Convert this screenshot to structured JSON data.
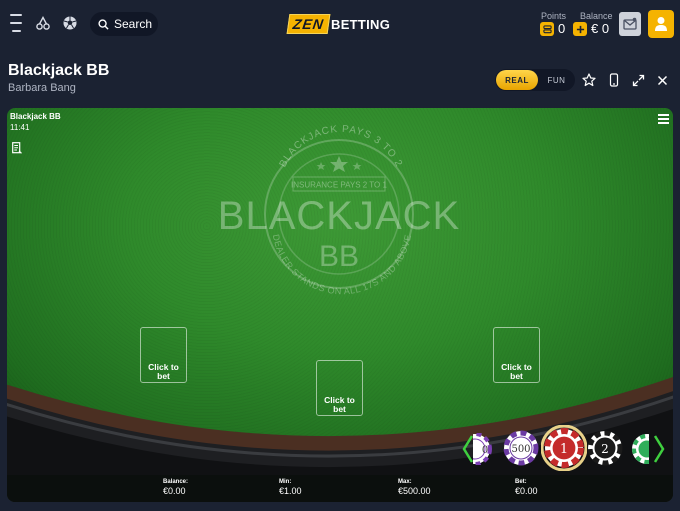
{
  "header": {
    "search_label": "Search",
    "logo_zen": "ZEN",
    "logo_betting": "BETTING",
    "points_label": "Points",
    "points_value": "0",
    "balance_label": "Balance",
    "balance_value": "€ 0",
    "accent_color": "#f5b301"
  },
  "game": {
    "title": "Blackjack BB",
    "provider": "Barbara Bang",
    "mode_real": "REAL",
    "mode_fun": "FUN",
    "selected_mode": "REAL"
  },
  "frame": {
    "title": "Blackjack BB",
    "time": "11:41",
    "table_arc_top": "BLACKJACK PAYS 3 TO 2",
    "insurance": "INSURANCE PAYS 2 TO 1",
    "table_name": "BLACKJACK",
    "table_sub": "BB",
    "table_arc_bottom": "DEALER STANDS ON ALL 17S AND ABOVE",
    "spots": [
      {
        "label": "Click to bet"
      },
      {
        "label": "Click to bet"
      },
      {
        "label": "Click to bet"
      }
    ],
    "stats": {
      "balance_key": "Balance:",
      "balance_val": "€0.00",
      "min_key": "Min:",
      "min_val": "€1.00",
      "max_key": "Max:",
      "max_val": "€500.00",
      "bet_key": "Bet:",
      "bet_val": "€0.00"
    },
    "chips": {
      "partial_left": "0",
      "c500": "500",
      "c1": "1",
      "c2": "2",
      "selected": "1"
    }
  }
}
